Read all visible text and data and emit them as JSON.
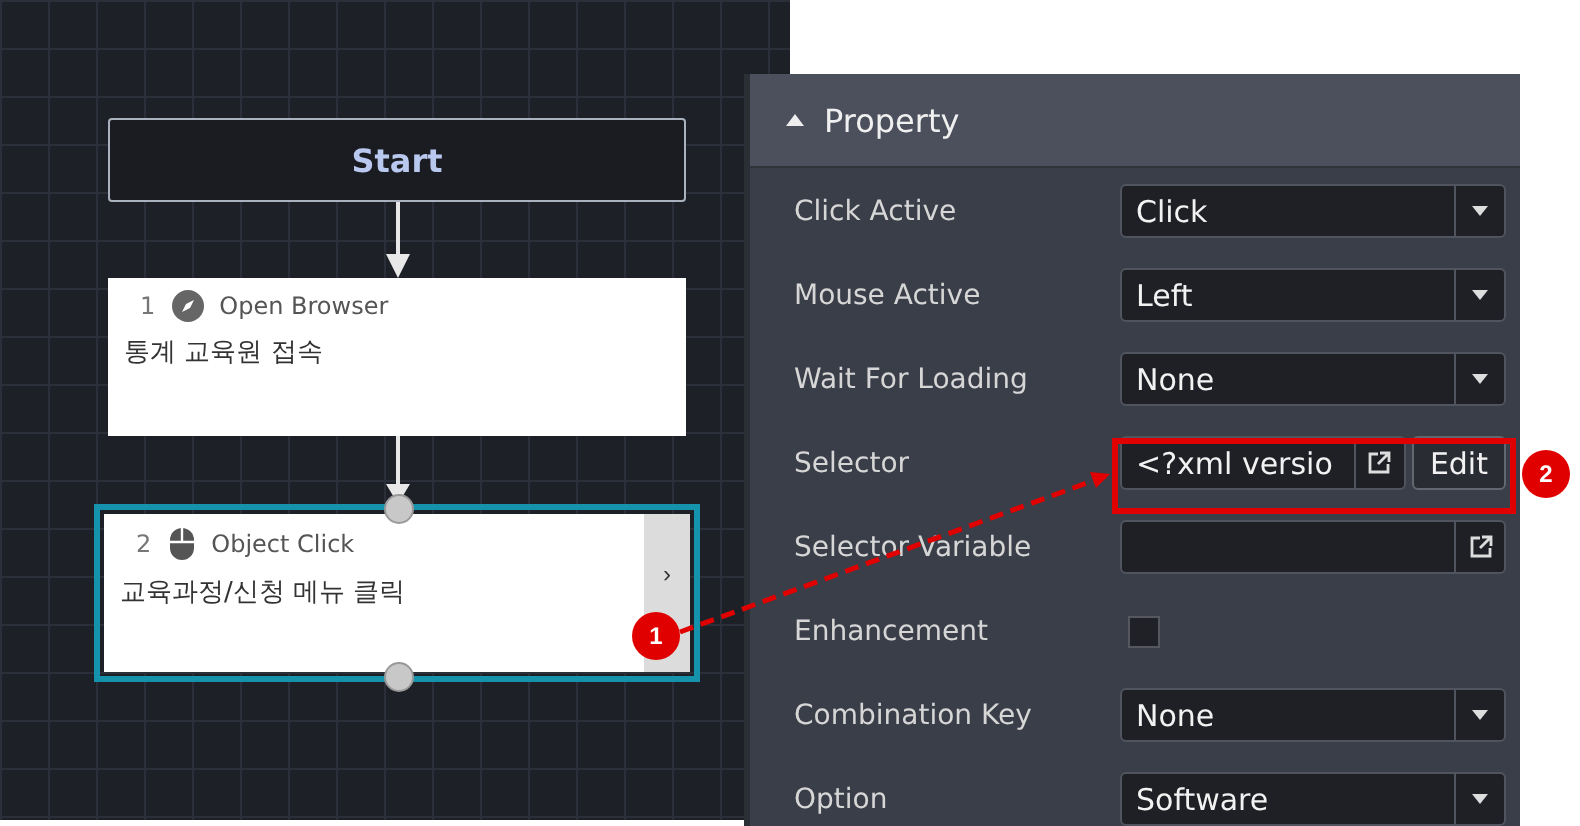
{
  "canvas": {
    "nodes": [
      {
        "kind": "start",
        "label": "Start",
        "selected": false
      },
      {
        "kind": "browser",
        "number": "1",
        "title": "Open Browser",
        "description": "통계 교육원 접속",
        "selected": false
      },
      {
        "kind": "click",
        "number": "2",
        "title": "Object Click",
        "description": "교육과정/신청 메뉴 클릭",
        "selected": true,
        "expand_label": "›"
      }
    ]
  },
  "property_panel": {
    "title": "Property",
    "expanded": true,
    "rows": [
      {
        "kind": "select",
        "label": "Click Active",
        "value": "Click"
      },
      {
        "kind": "select",
        "label": "Mouse Active",
        "value": "Left"
      },
      {
        "kind": "select",
        "label": "Wait For Loading",
        "value": "None"
      },
      {
        "kind": "selector",
        "label": "Selector",
        "value": "<?xml versio",
        "button": "Edit"
      },
      {
        "kind": "link",
        "label": "Selector Variable"
      },
      {
        "kind": "checkbox",
        "label": "Enhancement",
        "checked": false
      },
      {
        "kind": "select",
        "label": "Combination Key",
        "value": "None"
      },
      {
        "kind": "select",
        "label": "Option",
        "value": "Software"
      }
    ]
  },
  "callouts": [
    {
      "number": "1"
    },
    {
      "number": "2"
    }
  ]
}
